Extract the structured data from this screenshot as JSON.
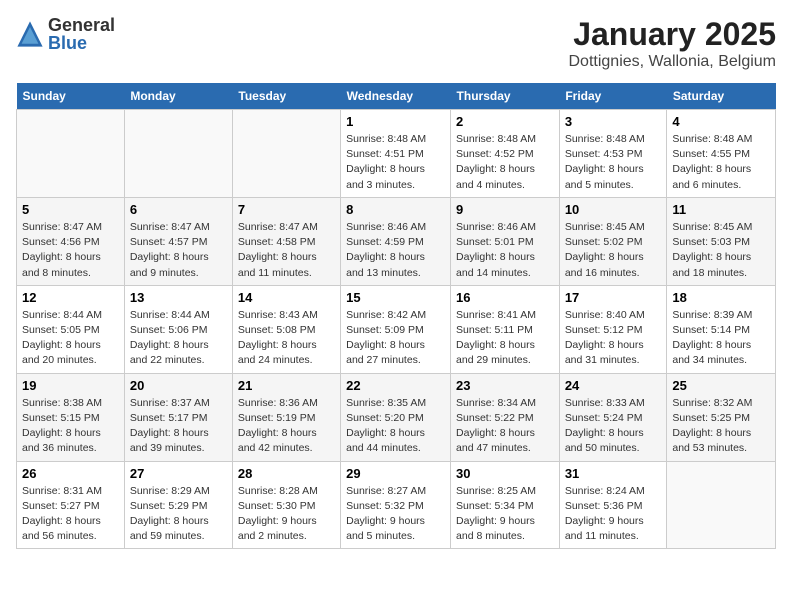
{
  "logo": {
    "general": "General",
    "blue": "Blue"
  },
  "title": "January 2025",
  "location": "Dottignies, Wallonia, Belgium",
  "headers": [
    "Sunday",
    "Monday",
    "Tuesday",
    "Wednesday",
    "Thursday",
    "Friday",
    "Saturday"
  ],
  "weeks": [
    [
      {
        "day": "",
        "info": ""
      },
      {
        "day": "",
        "info": ""
      },
      {
        "day": "",
        "info": ""
      },
      {
        "day": "1",
        "info": "Sunrise: 8:48 AM\nSunset: 4:51 PM\nDaylight: 8 hours\nand 3 minutes."
      },
      {
        "day": "2",
        "info": "Sunrise: 8:48 AM\nSunset: 4:52 PM\nDaylight: 8 hours\nand 4 minutes."
      },
      {
        "day": "3",
        "info": "Sunrise: 8:48 AM\nSunset: 4:53 PM\nDaylight: 8 hours\nand 5 minutes."
      },
      {
        "day": "4",
        "info": "Sunrise: 8:48 AM\nSunset: 4:55 PM\nDaylight: 8 hours\nand 6 minutes."
      }
    ],
    [
      {
        "day": "5",
        "info": "Sunrise: 8:47 AM\nSunset: 4:56 PM\nDaylight: 8 hours\nand 8 minutes."
      },
      {
        "day": "6",
        "info": "Sunrise: 8:47 AM\nSunset: 4:57 PM\nDaylight: 8 hours\nand 9 minutes."
      },
      {
        "day": "7",
        "info": "Sunrise: 8:47 AM\nSunset: 4:58 PM\nDaylight: 8 hours\nand 11 minutes."
      },
      {
        "day": "8",
        "info": "Sunrise: 8:46 AM\nSunset: 4:59 PM\nDaylight: 8 hours\nand 13 minutes."
      },
      {
        "day": "9",
        "info": "Sunrise: 8:46 AM\nSunset: 5:01 PM\nDaylight: 8 hours\nand 14 minutes."
      },
      {
        "day": "10",
        "info": "Sunrise: 8:45 AM\nSunset: 5:02 PM\nDaylight: 8 hours\nand 16 minutes."
      },
      {
        "day": "11",
        "info": "Sunrise: 8:45 AM\nSunset: 5:03 PM\nDaylight: 8 hours\nand 18 minutes."
      }
    ],
    [
      {
        "day": "12",
        "info": "Sunrise: 8:44 AM\nSunset: 5:05 PM\nDaylight: 8 hours\nand 20 minutes."
      },
      {
        "day": "13",
        "info": "Sunrise: 8:44 AM\nSunset: 5:06 PM\nDaylight: 8 hours\nand 22 minutes."
      },
      {
        "day": "14",
        "info": "Sunrise: 8:43 AM\nSunset: 5:08 PM\nDaylight: 8 hours\nand 24 minutes."
      },
      {
        "day": "15",
        "info": "Sunrise: 8:42 AM\nSunset: 5:09 PM\nDaylight: 8 hours\nand 27 minutes."
      },
      {
        "day": "16",
        "info": "Sunrise: 8:41 AM\nSunset: 5:11 PM\nDaylight: 8 hours\nand 29 minutes."
      },
      {
        "day": "17",
        "info": "Sunrise: 8:40 AM\nSunset: 5:12 PM\nDaylight: 8 hours\nand 31 minutes."
      },
      {
        "day": "18",
        "info": "Sunrise: 8:39 AM\nSunset: 5:14 PM\nDaylight: 8 hours\nand 34 minutes."
      }
    ],
    [
      {
        "day": "19",
        "info": "Sunrise: 8:38 AM\nSunset: 5:15 PM\nDaylight: 8 hours\nand 36 minutes."
      },
      {
        "day": "20",
        "info": "Sunrise: 8:37 AM\nSunset: 5:17 PM\nDaylight: 8 hours\nand 39 minutes."
      },
      {
        "day": "21",
        "info": "Sunrise: 8:36 AM\nSunset: 5:19 PM\nDaylight: 8 hours\nand 42 minutes."
      },
      {
        "day": "22",
        "info": "Sunrise: 8:35 AM\nSunset: 5:20 PM\nDaylight: 8 hours\nand 44 minutes."
      },
      {
        "day": "23",
        "info": "Sunrise: 8:34 AM\nSunset: 5:22 PM\nDaylight: 8 hours\nand 47 minutes."
      },
      {
        "day": "24",
        "info": "Sunrise: 8:33 AM\nSunset: 5:24 PM\nDaylight: 8 hours\nand 50 minutes."
      },
      {
        "day": "25",
        "info": "Sunrise: 8:32 AM\nSunset: 5:25 PM\nDaylight: 8 hours\nand 53 minutes."
      }
    ],
    [
      {
        "day": "26",
        "info": "Sunrise: 8:31 AM\nSunset: 5:27 PM\nDaylight: 8 hours\nand 56 minutes."
      },
      {
        "day": "27",
        "info": "Sunrise: 8:29 AM\nSunset: 5:29 PM\nDaylight: 8 hours\nand 59 minutes."
      },
      {
        "day": "28",
        "info": "Sunrise: 8:28 AM\nSunset: 5:30 PM\nDaylight: 9 hours\nand 2 minutes."
      },
      {
        "day": "29",
        "info": "Sunrise: 8:27 AM\nSunset: 5:32 PM\nDaylight: 9 hours\nand 5 minutes."
      },
      {
        "day": "30",
        "info": "Sunrise: 8:25 AM\nSunset: 5:34 PM\nDaylight: 9 hours\nand 8 minutes."
      },
      {
        "day": "31",
        "info": "Sunrise: 8:24 AM\nSunset: 5:36 PM\nDaylight: 9 hours\nand 11 minutes."
      },
      {
        "day": "",
        "info": ""
      }
    ]
  ]
}
